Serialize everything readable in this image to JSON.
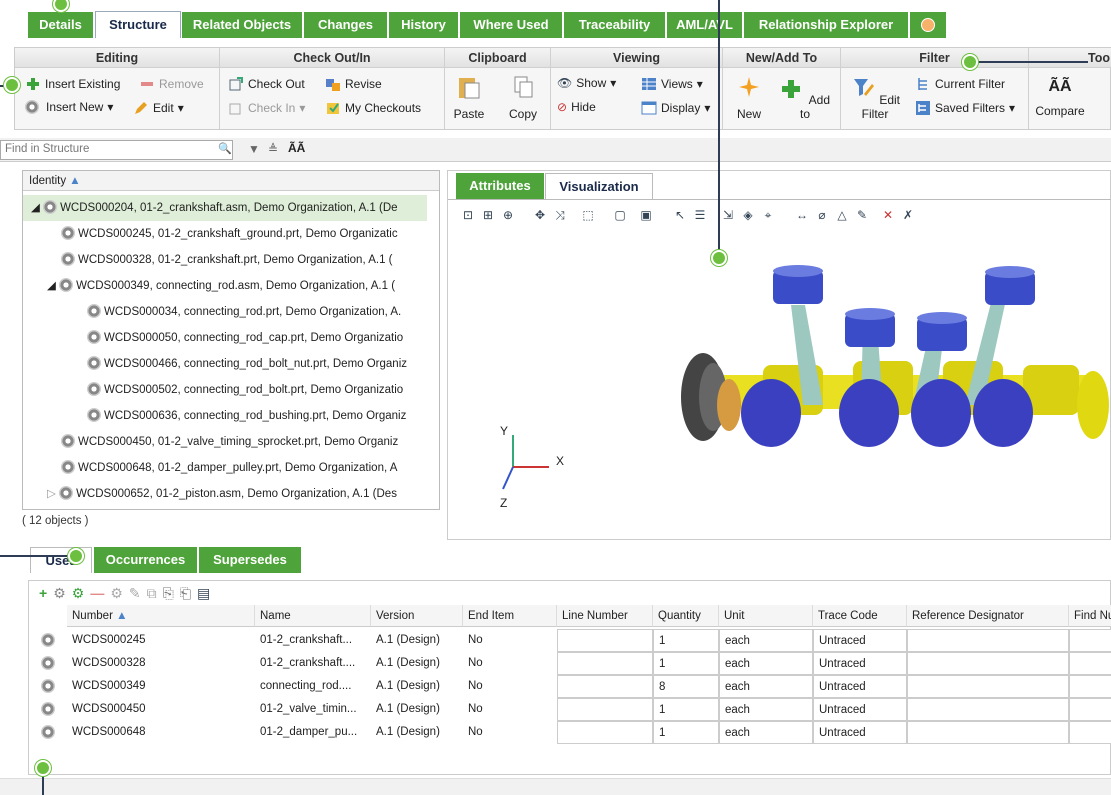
{
  "tabs": {
    "items": [
      {
        "label": "Details"
      },
      {
        "label": "Structure"
      },
      {
        "label": "Related Objects"
      },
      {
        "label": "Changes"
      },
      {
        "label": "History"
      },
      {
        "label": "Where Used"
      },
      {
        "label": "Traceability"
      },
      {
        "label": "AML/AVL"
      },
      {
        "label": "Relationship Explorer"
      }
    ],
    "active": "Structure"
  },
  "ribbon": {
    "editing": {
      "title": "Editing",
      "insert_existing": "Insert Existing",
      "remove": "Remove",
      "insert_new": "Insert New",
      "edit": "Edit"
    },
    "checkout": {
      "title": "Check Out/In",
      "check_out": "Check Out",
      "revise": "Revise",
      "check_in": "Check In",
      "my_checkouts": "My Checkouts"
    },
    "clipboard": {
      "title": "Clipboard",
      "paste": "Paste",
      "copy": "Copy"
    },
    "viewing": {
      "title": "Viewing",
      "show": "Show",
      "views": "Views",
      "hide": "Hide",
      "display": "Display"
    },
    "newadd": {
      "title": "New/Add To",
      "new": "New",
      "add_to": "Add to"
    },
    "filter": {
      "title": "Filter",
      "edit_filter": "Edit Filter",
      "current_filter": "Current Filter",
      "saved_filters": "Saved Filters"
    },
    "tools": {
      "title": "Too",
      "compare": "Compare"
    }
  },
  "find": {
    "placeholder": "Find in Structure"
  },
  "tree": {
    "header": "Identity",
    "rows": [
      {
        "label": "WCDS000204, 01-2_crankshaft.asm, Demo Organization, A.1 (De"
      },
      {
        "label": "WCDS000245, 01-2_crankshaft_ground.prt, Demo Organizatic"
      },
      {
        "label": "WCDS000328, 01-2_crankshaft.prt, Demo Organization, A.1 ("
      },
      {
        "label": "WCDS000349, connecting_rod.asm, Demo Organization, A.1 ("
      },
      {
        "label": "WCDS000034, connecting_rod.prt, Demo Organization, A."
      },
      {
        "label": "WCDS000050, connecting_rod_cap.prt, Demo Organizatio"
      },
      {
        "label": "WCDS000466, connecting_rod_bolt_nut.prt, Demo Organiz"
      },
      {
        "label": "WCDS000502, connecting_rod_bolt.prt, Demo Organizatio"
      },
      {
        "label": "WCDS000636, connecting_rod_bushing.prt, Demo Organiz"
      },
      {
        "label": "WCDS000450, 01-2_valve_timing_sprocket.prt, Demo Organiz"
      },
      {
        "label": "WCDS000648, 01-2_damper_pulley.prt, Demo Organization, A"
      },
      {
        "label": "WCDS000652, 01-2_piston.asm, Demo Organization, A.1 (Des"
      }
    ],
    "count": "( 12 objects )"
  },
  "panel_tabs": {
    "attributes": "Attributes",
    "visualization": "Visualization"
  },
  "axes": {
    "x": "X",
    "y": "Y",
    "z": "Z"
  },
  "bottom_tabs": {
    "uses": "Uses",
    "occurrences": "Occurrences",
    "supersedes": "Supersedes"
  },
  "grid": {
    "headers": [
      "Number",
      "Name",
      "Version",
      "End Item",
      "Line Number",
      "Quantity",
      "Unit",
      "Trace Code",
      "Reference Designator",
      "Find Nu"
    ],
    "rows": [
      {
        "number": "WCDS000245",
        "name": "01-2_crankshaft...",
        "version": "A.1 (Design)",
        "end_item": "No",
        "line": "",
        "qty": "1",
        "unit": "each",
        "trace": "Untraced"
      },
      {
        "number": "WCDS000328",
        "name": "01-2_crankshaft....",
        "version": "A.1 (Design)",
        "end_item": "No",
        "line": "",
        "qty": "1",
        "unit": "each",
        "trace": "Untraced"
      },
      {
        "number": "WCDS000349",
        "name": "connecting_rod....",
        "version": "A.1 (Design)",
        "end_item": "No",
        "line": "",
        "qty": "8",
        "unit": "each",
        "trace": "Untraced"
      },
      {
        "number": "WCDS000450",
        "name": "01-2_valve_timin...",
        "version": "A.1 (Design)",
        "end_item": "No",
        "line": "",
        "qty": "1",
        "unit": "each",
        "trace": "Untraced"
      },
      {
        "number": "WCDS000648",
        "name": "01-2_damper_pu...",
        "version": "A.1 (Design)",
        "end_item": "No",
        "line": "",
        "qty": "1",
        "unit": "each",
        "trace": "Untraced"
      }
    ]
  },
  "colors": {
    "tab_green": "#4ea33a",
    "callout": "#6cbf3f",
    "line": "#2e3c56"
  }
}
